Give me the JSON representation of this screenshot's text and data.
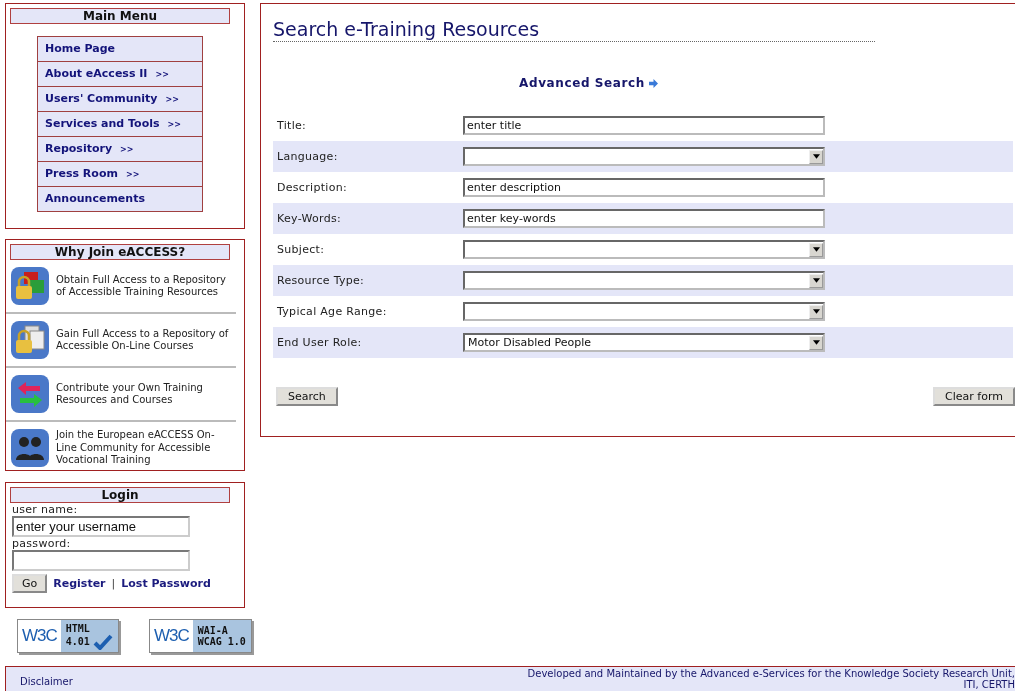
{
  "main_menu": {
    "title": "Main Menu",
    "items": [
      {
        "label": "Home Page",
        "submenu": false
      },
      {
        "label": "About eAccess II",
        "submenu": true
      },
      {
        "label": "Users' Community",
        "submenu": true
      },
      {
        "label": "Services and Tools",
        "submenu": true
      },
      {
        "label": "Repository",
        "submenu": true
      },
      {
        "label": "Press Room",
        "submenu": true
      },
      {
        "label": "Announcements",
        "submenu": false
      }
    ],
    "submenu_marker": ">>"
  },
  "why_join": {
    "title": "Why Join eACCESS?",
    "items": [
      {
        "kind": "lock-blocks",
        "text": "Obtain Full Access to a Repository of Accessible Training Resources"
      },
      {
        "kind": "lock-pages",
        "text": "Gain Full Access to a Repository of Accessible On-Line Courses"
      },
      {
        "kind": "arrows",
        "text": "Contribute your Own Training Resources and Courses"
      },
      {
        "kind": "people",
        "text": "Join the European eACCESS On-Line Community for Accessible Vocational Training"
      }
    ]
  },
  "login": {
    "title": "Login",
    "username_label": "user name:",
    "username_value": "enter your username",
    "password_label": "password:",
    "go_button": "Go",
    "register_link": "Register",
    "separator": "|",
    "lost_password_link": "Lost Password"
  },
  "badges": [
    {
      "kind": "html",
      "logo": "W3C",
      "line1": "HTML",
      "line2": "4.01"
    },
    {
      "kind": "wcag",
      "logo": "W3C",
      "line1": "WAI-A",
      "line2": "WCAG 1.0"
    }
  ],
  "search": {
    "title": "Search e-Training Resources",
    "advanced_link": "Advanced Search",
    "fields": [
      {
        "label": "Title:",
        "kind": "text",
        "value": "enter title"
      },
      {
        "label": "Language:",
        "kind": "select"
      },
      {
        "label": "Description:",
        "kind": "text",
        "value": "enter description"
      },
      {
        "label": "Key-Words:",
        "kind": "text",
        "value": "enter key-words"
      },
      {
        "label": "Subject:",
        "kind": "select"
      },
      {
        "label": "Resource Type:",
        "kind": "select"
      },
      {
        "label": "Typical Age Range:",
        "kind": "select"
      },
      {
        "label": "End User Role:",
        "kind": "select",
        "value": "Motor Disabled People"
      }
    ],
    "search_button": "Search",
    "clear_button": "Clear form"
  },
  "footer": {
    "left": "Disclaimer",
    "right_line1": "Developed and Maintained by the Advanced e-Services for the Knowledge Society Research Unit,",
    "right_line2": "ITI, CERTH"
  }
}
